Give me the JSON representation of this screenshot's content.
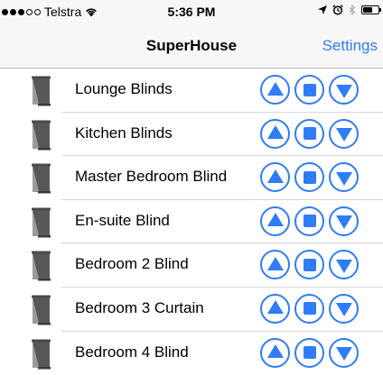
{
  "status_bar": {
    "carrier": "Telstra",
    "time": "5:36 PM",
    "signal_bars_filled": 3,
    "signal_bars_total": 5,
    "icons": [
      "wifi-icon",
      "location-arrow-icon",
      "alarm-icon",
      "bluetooth-icon",
      "battery-icon"
    ],
    "battery_level": 0.6
  },
  "nav": {
    "title": "SuperHouse",
    "settings_label": "Settings"
  },
  "colors": {
    "accent": "#2f7cf6",
    "bar_background": "#f7f7f7",
    "separator": "#d6d6da"
  },
  "rows": [
    {
      "label": "Lounge Blinds"
    },
    {
      "label": "Kitchen Blinds"
    },
    {
      "label": "Master Bedroom Blind"
    },
    {
      "label": "En-suite Blind"
    },
    {
      "label": "Bedroom 2 Blind"
    },
    {
      "label": "Bedroom 3 Curtain"
    },
    {
      "label": "Bedroom 4 Blind"
    }
  ],
  "row_controls": [
    "up-arrow-icon",
    "stop-icon",
    "down-arrow-icon"
  ]
}
